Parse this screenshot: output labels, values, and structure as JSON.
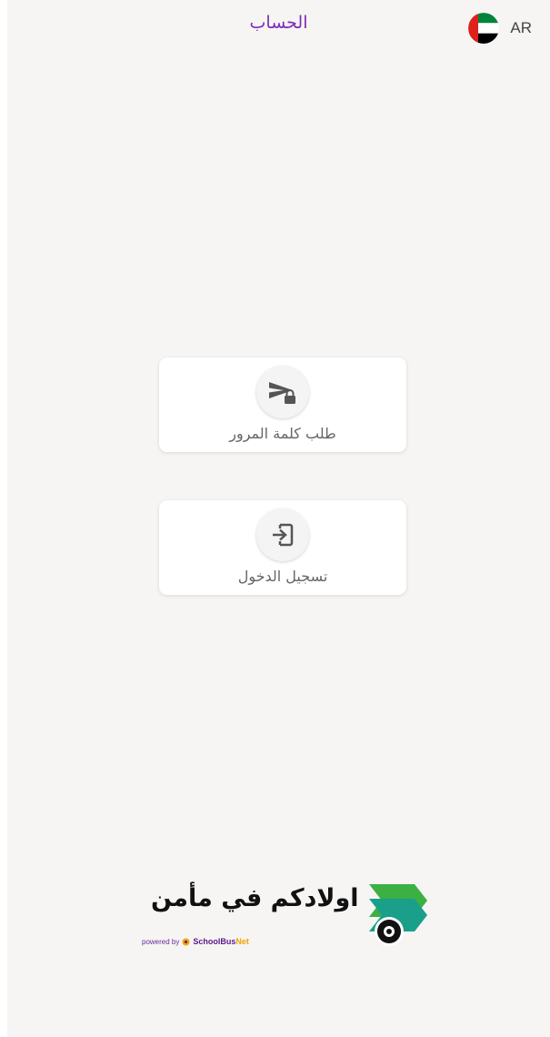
{
  "header": {
    "title": "الحساب",
    "language_code": "AR",
    "flag_icon": "uae-flag-icon"
  },
  "cards": [
    {
      "label": "طلب كلمة المرور",
      "icon": "send-lock-icon"
    },
    {
      "label": "تسجيل الدخول",
      "icon": "login-icon"
    }
  ],
  "footer": {
    "slogan": "اولادكم في مأمن",
    "powered_by": "powered by",
    "brand_school": "SchoolBus",
    "brand_net": "Net"
  },
  "colors": {
    "title": "#7d2bb8",
    "background": "#f6f5f4",
    "logo_green": "#3cb043",
    "logo_teal": "#1a9f8a"
  }
}
